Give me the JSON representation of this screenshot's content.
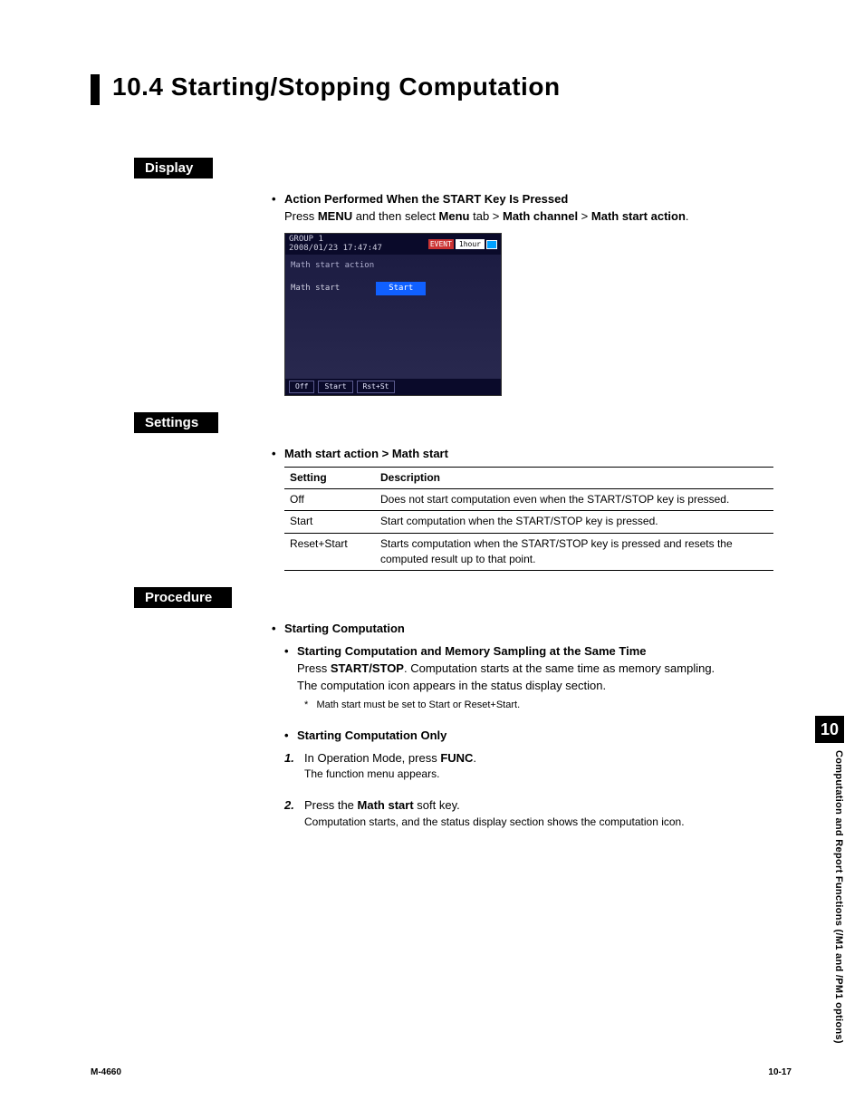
{
  "title": "10.4   Starting/Stopping Computation",
  "sections": {
    "display": {
      "label": "Display",
      "action_heading": "Action Performed When the START Key Is Pressed",
      "path_prefix": "Press ",
      "path_menu": "MENU",
      "path_mid1": " and then select ",
      "path_menu_tab": "Menu",
      "path_mid2": " tab > ",
      "path_math_channel": "Math channel",
      "path_mid3": " > ",
      "path_math_start_action": "Math start action",
      "path_end": ".",
      "screenshot": {
        "group": "GROUP 1",
        "timestamp": "2008/01/23 17:47:47",
        "event_label": "EVENT",
        "time_badge": "1hour",
        "line1": "Math start action",
        "row_label": "Math start",
        "row_value": "Start",
        "softkeys": [
          "Off",
          "Start",
          "Rst+St"
        ]
      }
    },
    "settings": {
      "label": "Settings",
      "heading": "Math start action > Math start",
      "columns": [
        "Setting",
        "Description"
      ],
      "rows": [
        {
          "setting": "Off",
          "desc": "Does not start computation even when the START/STOP key is pressed."
        },
        {
          "setting": "Start",
          "desc": "Start computation when the START/STOP key is pressed."
        },
        {
          "setting": "Reset+Start",
          "desc": "Starts computation when the START/STOP key is pressed and resets the computed result up to that point."
        }
      ]
    },
    "procedure": {
      "label": "Procedure",
      "starting_heading": "Starting Computation",
      "sub1_heading": "Starting Computation and Memory Sampling at the Same Time",
      "sub1_line1a": "Press ",
      "sub1_line1b": "START/STOP",
      "sub1_line1c": ". Computation starts at the same time as memory sampling.",
      "sub1_line2": "The computation icon appears in the status display section.",
      "sub1_note": "Math start must be set to Start or Reset+Start.",
      "sub2_heading": "Starting Computation Only",
      "step1_num": "1.",
      "step1a": "In Operation Mode, press ",
      "step1b": "FUNC",
      "step1c": ".",
      "step1_sub": "The function menu appears.",
      "step2_num": "2.",
      "step2a": "Press the ",
      "step2b": "Math start",
      "step2c": " soft key.",
      "step2_sub": "Computation starts, and the status display section shows the computation icon."
    }
  },
  "side": {
    "chapter": "10",
    "label": "Computation and Report Functions (/M1 and /PM1 options)"
  },
  "footer": {
    "left": "M-4660",
    "right": "10-17"
  }
}
